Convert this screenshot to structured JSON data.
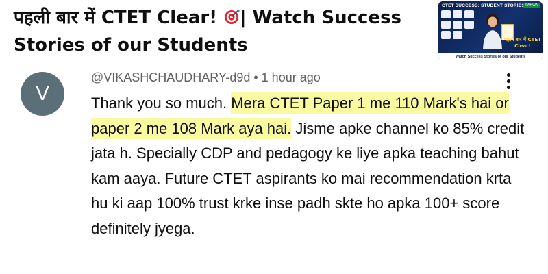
{
  "video": {
    "title": "पहली बार में CTET Clear! ",
    "title_rest": "| Watch Success Stories of our Students",
    "title_icon": "target-icon"
  },
  "thumbnail": {
    "top_text": "CTET SUCCESS: STUDENT STORIES",
    "logo_text": "PAHWA",
    "hindi_text": "पहली बार में CTET Clear!",
    "bottom_text": "Watch Success Stories of our Students"
  },
  "comment": {
    "avatar_letter": "V",
    "avatar_color": "#5a6f78",
    "author": "@VIKASHCHAUDHARY-d9d",
    "separator": " • ",
    "time": "1 hour ago",
    "text_before": "Thank you so much. ",
    "text_highlight": "Mera CTET Paper 1 me 110 Mark's hai or paper 2 me 108 Mark aya hai.",
    "text_after": " Jisme apke channel ko 85% credit jata h. Specially CDP and pedagogy ke liye apka teaching bahut kam aaya. Future CTET aspirants ko mai recommendation krta hu ki aap 100% trust krke inse padh skte ho apka 100+ score definitely jyega.",
    "highlight_color": "#fafaa0",
    "menu_icon": "more-vert-icon"
  }
}
